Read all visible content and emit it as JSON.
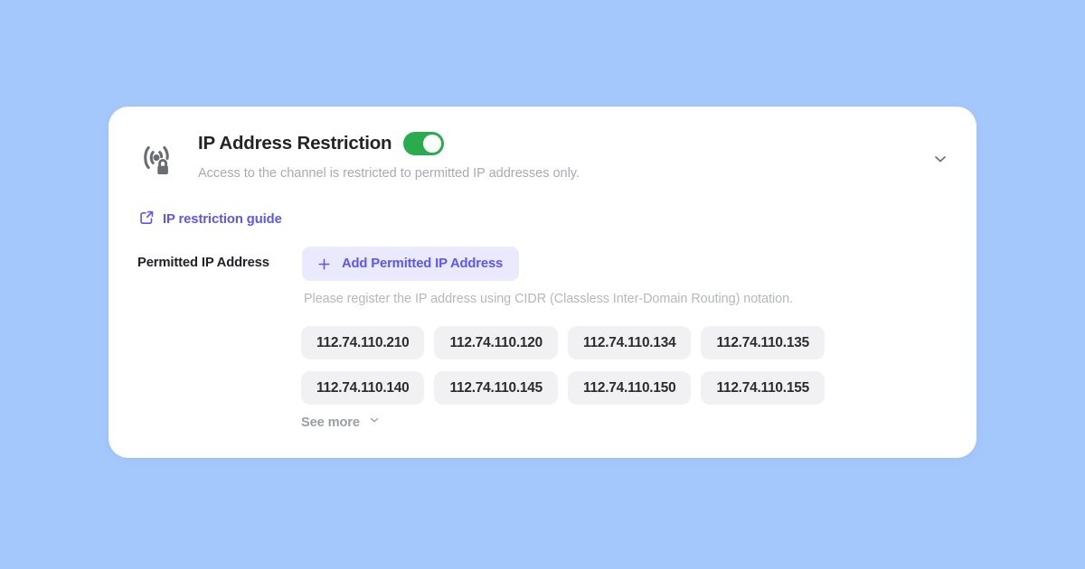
{
  "background_color": "#a5c8fc",
  "card": {
    "header": {
      "icon": "wireless-lock-icon",
      "title": "IP Address Restriction",
      "subtitle": "Access to the channel is restricted to permitted IP addresses only.",
      "toggle": {
        "name": "ip-restriction-toggle",
        "state": "on",
        "on_color": "#2aac4e"
      },
      "collapse_icon": "chevron-down-icon"
    },
    "guide_link": {
      "icon": "external-link-icon",
      "label": "IP restriction guide",
      "color": "#5b57f2"
    },
    "permitted": {
      "field_label": "Permitted IP Address",
      "add_button": {
        "icon": "plus-icon",
        "label": "Add Permitted IP Address",
        "bg_color": "#ebe9fd",
        "text_color": "#5b57f2"
      },
      "cidr_note": "Please register the IP address using CIDR (Classless Inter-Domain Routing) notation.",
      "ip_rows": [
        [
          "112.74.110.210",
          "112.74.110.120",
          "112.74.110.134",
          "112.74.110.135"
        ],
        [
          "112.74.110.140",
          "112.74.110.145",
          "112.74.110.150",
          "112.74.110.155"
        ]
      ],
      "see_more": {
        "label": "See more",
        "icon": "chevron-down-icon"
      }
    }
  }
}
